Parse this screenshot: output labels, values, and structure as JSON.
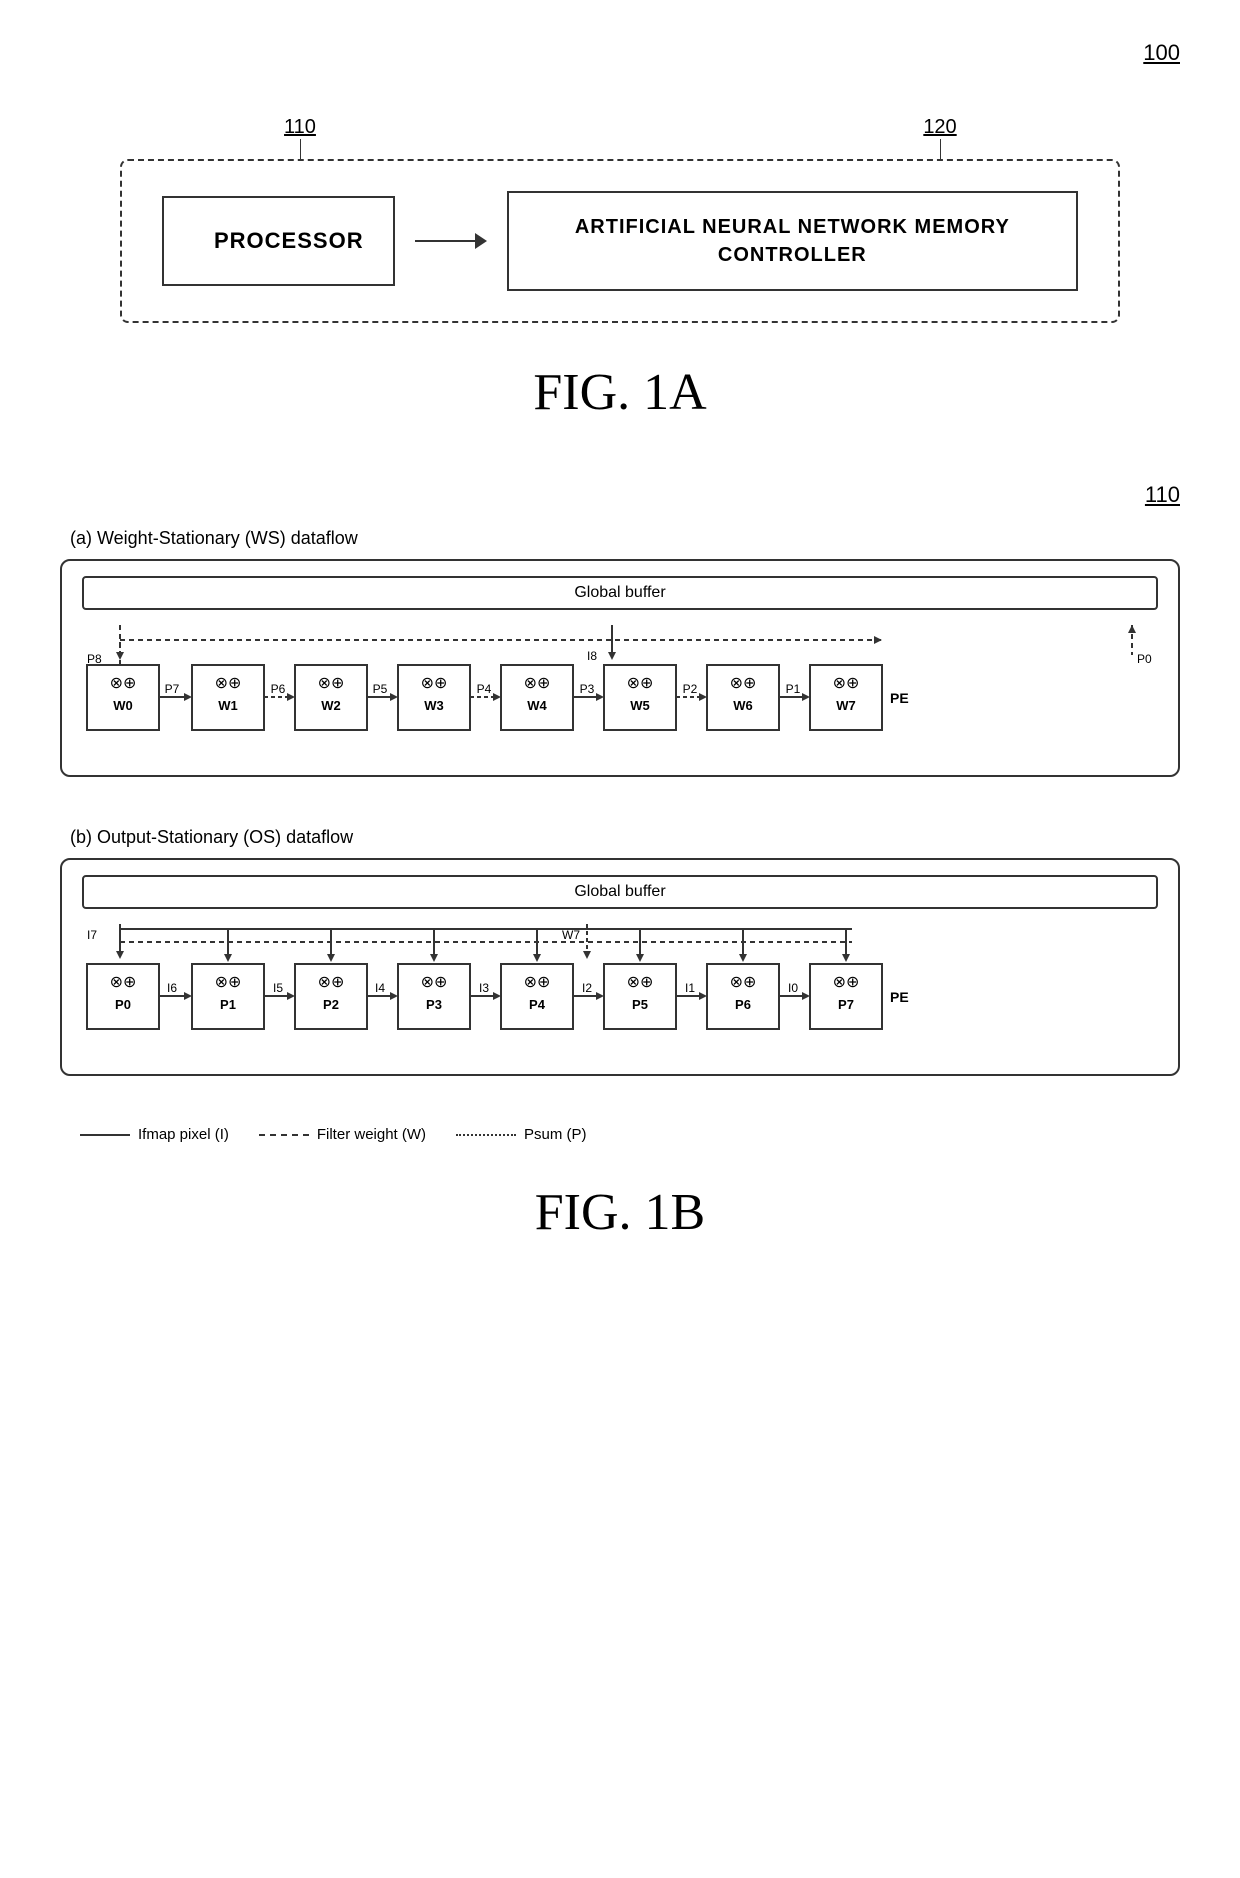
{
  "fig1a": {
    "number": "100",
    "label_110": "110",
    "label_120": "120",
    "processor_label": "PROCESSOR",
    "ann_label": "ARTIFICIAL NEURAL\nNETWORK MEMORY\nCONTROLLER",
    "caption": "FIG. 1A"
  },
  "fig1b": {
    "number": "110",
    "ws": {
      "label": "(a) Weight-Stationary (WS) dataflow",
      "global_buffer": "Global buffer",
      "pe_labels": [
        "W0",
        "W1",
        "W2",
        "W3",
        "W4",
        "W5",
        "W6",
        "W7"
      ],
      "between_labels": [
        "P7",
        "P6",
        "P5",
        "P4",
        "P3",
        "P2",
        "P1"
      ],
      "top_labels": [
        "P8",
        "I8",
        "P0"
      ]
    },
    "os": {
      "label": "(b) Output-Stationary (OS) dataflow",
      "global_buffer": "Global buffer",
      "pe_labels": [
        "P0",
        "P1",
        "P2",
        "P3",
        "P4",
        "P5",
        "P6",
        "P7"
      ],
      "between_labels": [
        "I6",
        "I5",
        "I4",
        "I3",
        "I2",
        "I1",
        "I0"
      ],
      "top_labels": [
        "I7",
        "W7"
      ]
    },
    "legend": {
      "ifmap": "Ifmap pixel (I)",
      "filter": "Filter weight (W)",
      "psum": "Psum (P)"
    },
    "caption": "FIG. 1B"
  }
}
